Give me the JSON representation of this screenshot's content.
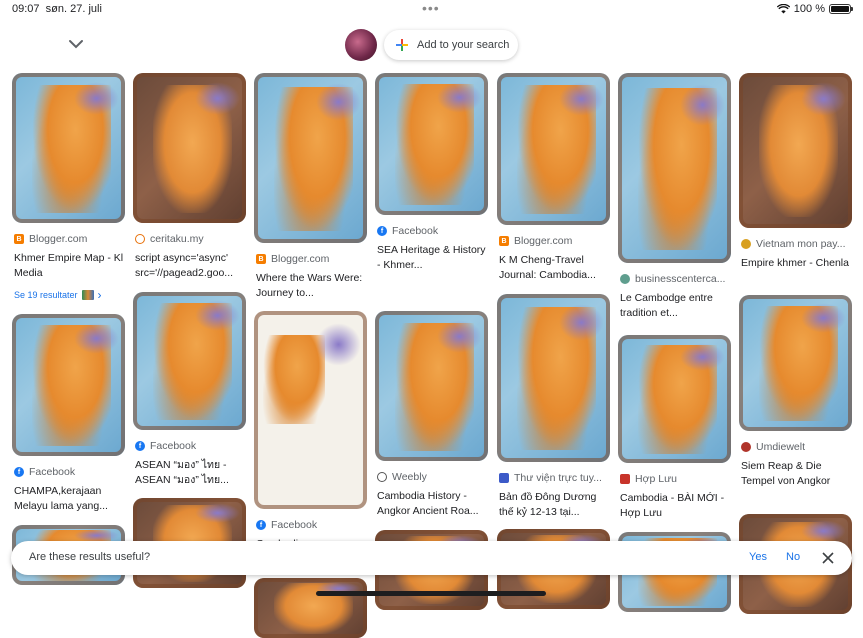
{
  "status_bar": {
    "time": "09:07",
    "date": "søn. 27. juli",
    "battery": "100 %"
  },
  "header": {
    "add_to_search": "Add to your search"
  },
  "more_results": "Se 19 resultater",
  "feedback": {
    "question": "Are these results useful?",
    "yes": "Yes",
    "no": "No"
  },
  "columns": [
    {
      "cards": [
        {
          "source": "Blogger.com",
          "icon": "blogger-icon",
          "title": "Khmer Empire Map - Kl Media",
          "variant": "map"
        },
        {
          "source": "Facebook",
          "icon": "facebook-icon",
          "title": "CHAMPA,kerajaan Melayu lama yang...",
          "variant": "map"
        },
        {
          "source": "",
          "icon": "",
          "title": "",
          "variant": "map"
        }
      ]
    },
    {
      "cards": [
        {
          "source": "ceritaku.my",
          "icon": "ceritaku-icon",
          "title": "script async='async' src='//pagead2.goo...",
          "variant": "dark"
        },
        {
          "source": "Facebook",
          "icon": "facebook-icon",
          "title": "ASEAN “มอง” ไทย - ASEAN “มอง” ไทย...",
          "variant": "map"
        },
        {
          "source": "",
          "icon": "",
          "title": "",
          "variant": "dark"
        }
      ]
    },
    {
      "cards": [
        {
          "source": "Blogger.com",
          "icon": "blogger-icon",
          "title": "Where the Wars Were: Journey to...",
          "variant": "map"
        },
        {
          "source": "Facebook",
          "icon": "facebook-icon",
          "title": "Cambodian...",
          "variant": "doc"
        },
        {
          "source": "",
          "icon": "",
          "title": "",
          "variant": "dark"
        }
      ]
    },
    {
      "cards": [
        {
          "source": "Facebook",
          "icon": "facebook-icon",
          "title": "SEA Heritage & History - Khmer...",
          "variant": "map"
        },
        {
          "source": "Weebly",
          "icon": "weebly-icon",
          "title": "Cambodia History - Angkor Ancient Roa...",
          "variant": "map"
        },
        {
          "source": "",
          "icon": "",
          "title": "",
          "variant": "dark"
        }
      ]
    },
    {
      "cards": [
        {
          "source": "Blogger.com",
          "icon": "blogger-icon",
          "title": "K M Cheng-Travel Journal: Cambodia...",
          "variant": "map"
        },
        {
          "source": "Thư viện trực tuy...",
          "icon": "thuvien-icon",
          "title": "Bản đồ Đông Dương thế kỷ 12-13 tại...",
          "variant": "map"
        },
        {
          "source": "",
          "icon": "",
          "title": "",
          "variant": "dark"
        }
      ]
    },
    {
      "cards": [
        {
          "source": "businesscenterca...",
          "icon": "business-icon",
          "title": "Le Cambodge entre tradition et...",
          "variant": "map"
        },
        {
          "source": "Hợp Lưu",
          "icon": "hopluu-icon",
          "title": "Cambodia - BÀI MỚI - Hợp Lưu",
          "variant": "map"
        },
        {
          "source": "",
          "icon": "",
          "title": "",
          "variant": "map"
        }
      ]
    },
    {
      "cards": [
        {
          "source": "Vietnam mon pay...",
          "icon": "vietnam-icon",
          "title": "Empire khmer - Chenla",
          "variant": "dark"
        },
        {
          "source": "Umdiewelt",
          "icon": "umdiewelt-icon",
          "title": "Siem Reap & Die Tempel von Angkor",
          "variant": "map"
        },
        {
          "source": "",
          "icon": "",
          "title": "",
          "variant": "dark"
        }
      ]
    }
  ]
}
